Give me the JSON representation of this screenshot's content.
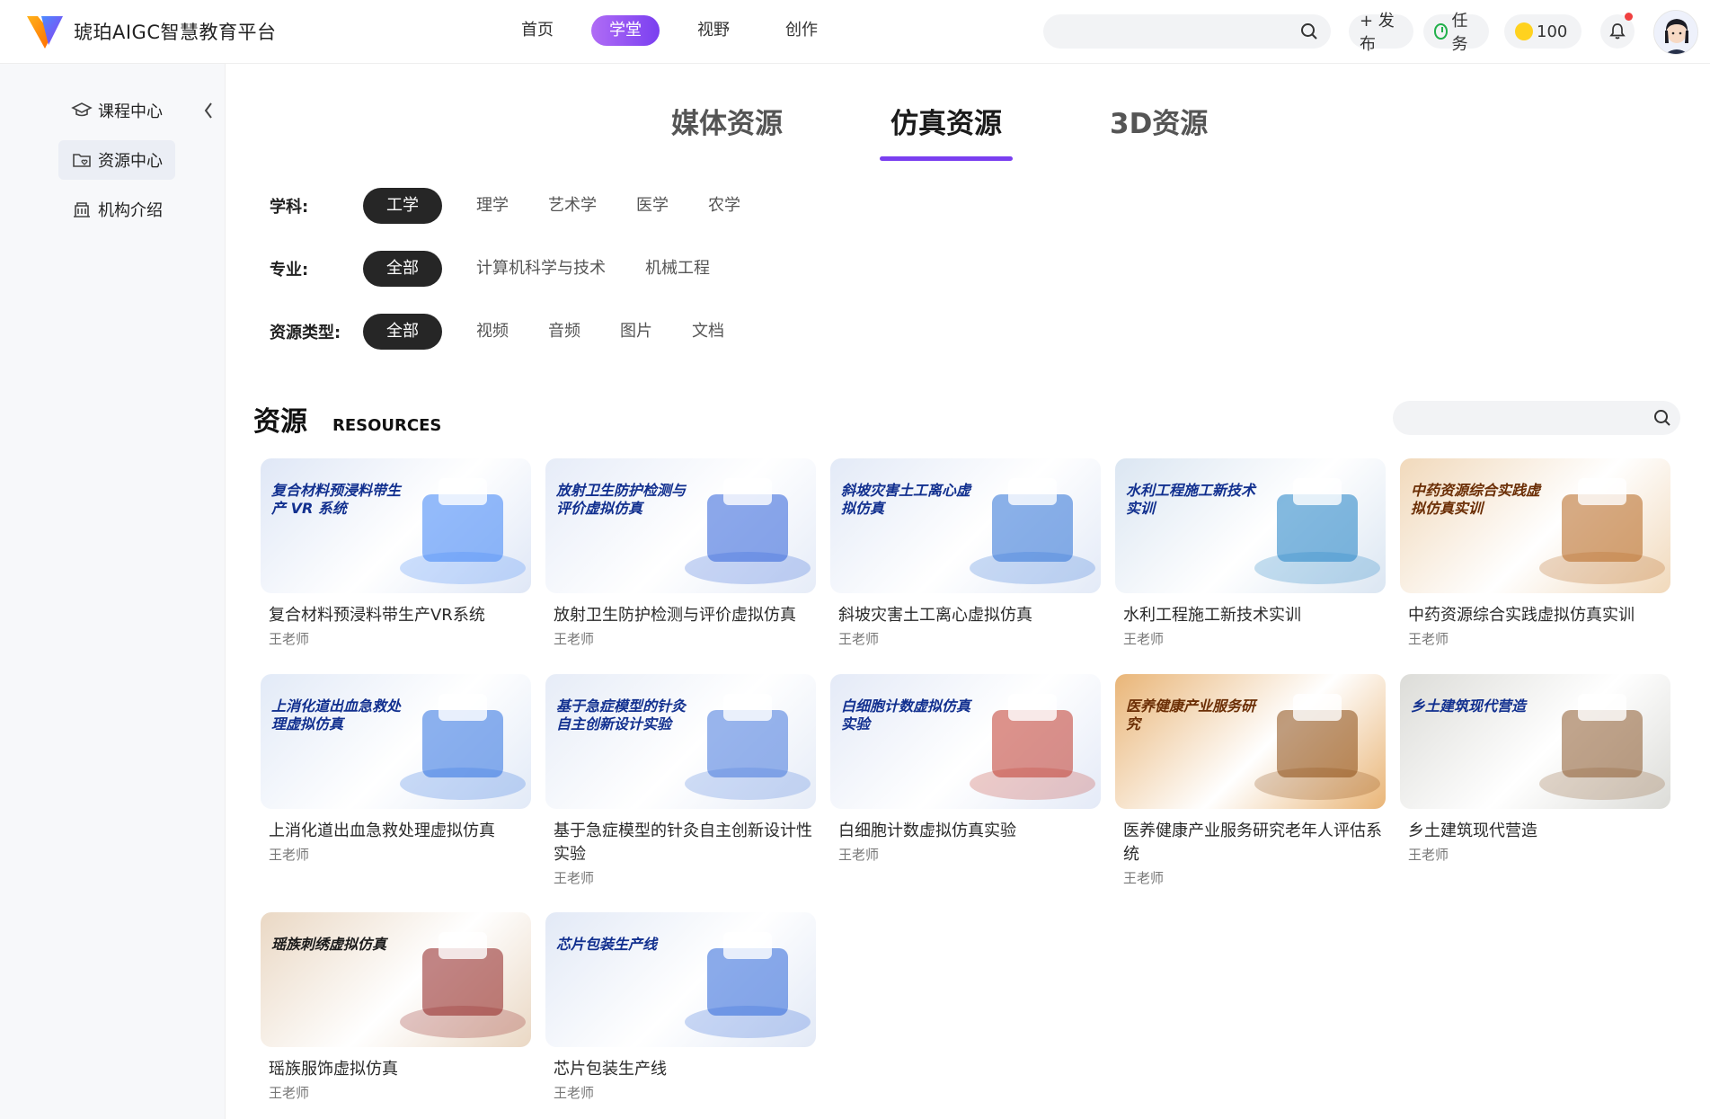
{
  "header": {
    "app_title": "琥珀AIGC智慧教育平台",
    "nav": [
      "首页",
      "学堂",
      "视野",
      "创作"
    ],
    "active_nav": 1,
    "search_placeholder": "",
    "publish_label": "+ 发布",
    "task_label": "任务",
    "coin_value": "100"
  },
  "sidebar": {
    "items": [
      {
        "label": "课程中心",
        "icon": "graduation-cap-icon"
      },
      {
        "label": "资源中心",
        "icon": "folder-heart-icon"
      },
      {
        "label": "机构介绍",
        "icon": "building-icon"
      }
    ],
    "active": 1
  },
  "tabs": {
    "items": [
      "媒体资源",
      "仿真资源",
      "3D资源"
    ],
    "active": 1
  },
  "filters": [
    {
      "label": "学科:",
      "options": [
        "工学",
        "理学",
        "艺术学",
        "医学",
        "农学"
      ],
      "active": 0
    },
    {
      "label": "专业:",
      "options": [
        "全部",
        "计算机科学与技术",
        "机械工程"
      ],
      "active": 0
    },
    {
      "label": "资源类型:",
      "options": [
        "全部",
        "视频",
        "音频",
        "图片",
        "文档"
      ],
      "active": 0
    }
  ],
  "section": {
    "title": "资源",
    "subtitle": "RESOURCES",
    "search_placeholder": ""
  },
  "resources": [
    {
      "title": "复合材料预浸料带生产VR系统",
      "author": "王老师",
      "thumb_text": "复合材料预浸料带生产 VR 系统",
      "bg": "#dfe7f6",
      "accent": "#3b82f6"
    },
    {
      "title": "放射卫生防护检测与评价虚拟仿真",
      "author": "王老师",
      "thumb_text": "放射卫生防护检测与评价虚拟仿真",
      "bg": "#e6ecf8",
      "accent": "#2b5fd9"
    },
    {
      "title": "斜坡灾害土工离心虚拟仿真",
      "author": "王老师",
      "thumb_text": "斜坡灾害土工离心虚拟仿真",
      "bg": "#e3eaf7",
      "accent": "#2a6fd6"
    },
    {
      "title": "水利工程施工新技术实训",
      "author": "王老师",
      "thumb_text": "水利工程施工新技术实训",
      "bg": "#dbe6f2",
      "accent": "#1d7fc4"
    },
    {
      "title": "中药资源综合实践虚拟仿真实训",
      "author": "王老师",
      "thumb_text": "中药资源综合实践虚拟仿真实训",
      "bg": "#f1d9bb",
      "accent": "#b5651d"
    },
    {
      "title": "上消化道出血急救处理虚拟仿真",
      "author": "王老师",
      "thumb_text": "上消化道出血急救处理虚拟仿真",
      "bg": "#e2eaf7",
      "accent": "#2b6fe0"
    },
    {
      "title": "基于急症模型的针灸自主创新设计性实验",
      "author": "王老师",
      "thumb_text": "基于急症模型的针灸自主创新设计实验",
      "bg": "#e6ecf7",
      "accent": "#4477dd"
    },
    {
      "title": "白细胞计数虚拟仿真实验",
      "author": "王老师",
      "thumb_text": "白细胞计数虚拟仿真实验",
      "bg": "#e4eaf7",
      "accent": "#c0392b"
    },
    {
      "title": "医养健康产业服务研究老年人评估系统",
      "author": "王老师",
      "thumb_text": "医养健康产业服务研究",
      "bg": "#e9b577",
      "accent": "#8a4a12"
    },
    {
      "title": "乡土建筑现代营造",
      "author": "王老师",
      "thumb_text": "乡土建筑现代营造",
      "bg": "#dcdcd8",
      "accent": "#8c5a2e"
    },
    {
      "title": "瑶族服饰虚拟仿真",
      "author": "王老师",
      "thumb_text": "瑶族刺绣虚拟仿真",
      "bg": "#ead8c4",
      "accent": "#8e1f1f"
    },
    {
      "title": "芯片包装生产线",
      "author": "王老师",
      "thumb_text": "芯片包装生产线",
      "bg": "#e2e9f6",
      "accent": "#2a65d8"
    }
  ],
  "colors": {
    "brand": "#7a3ff0",
    "chip_active": "#262626"
  }
}
